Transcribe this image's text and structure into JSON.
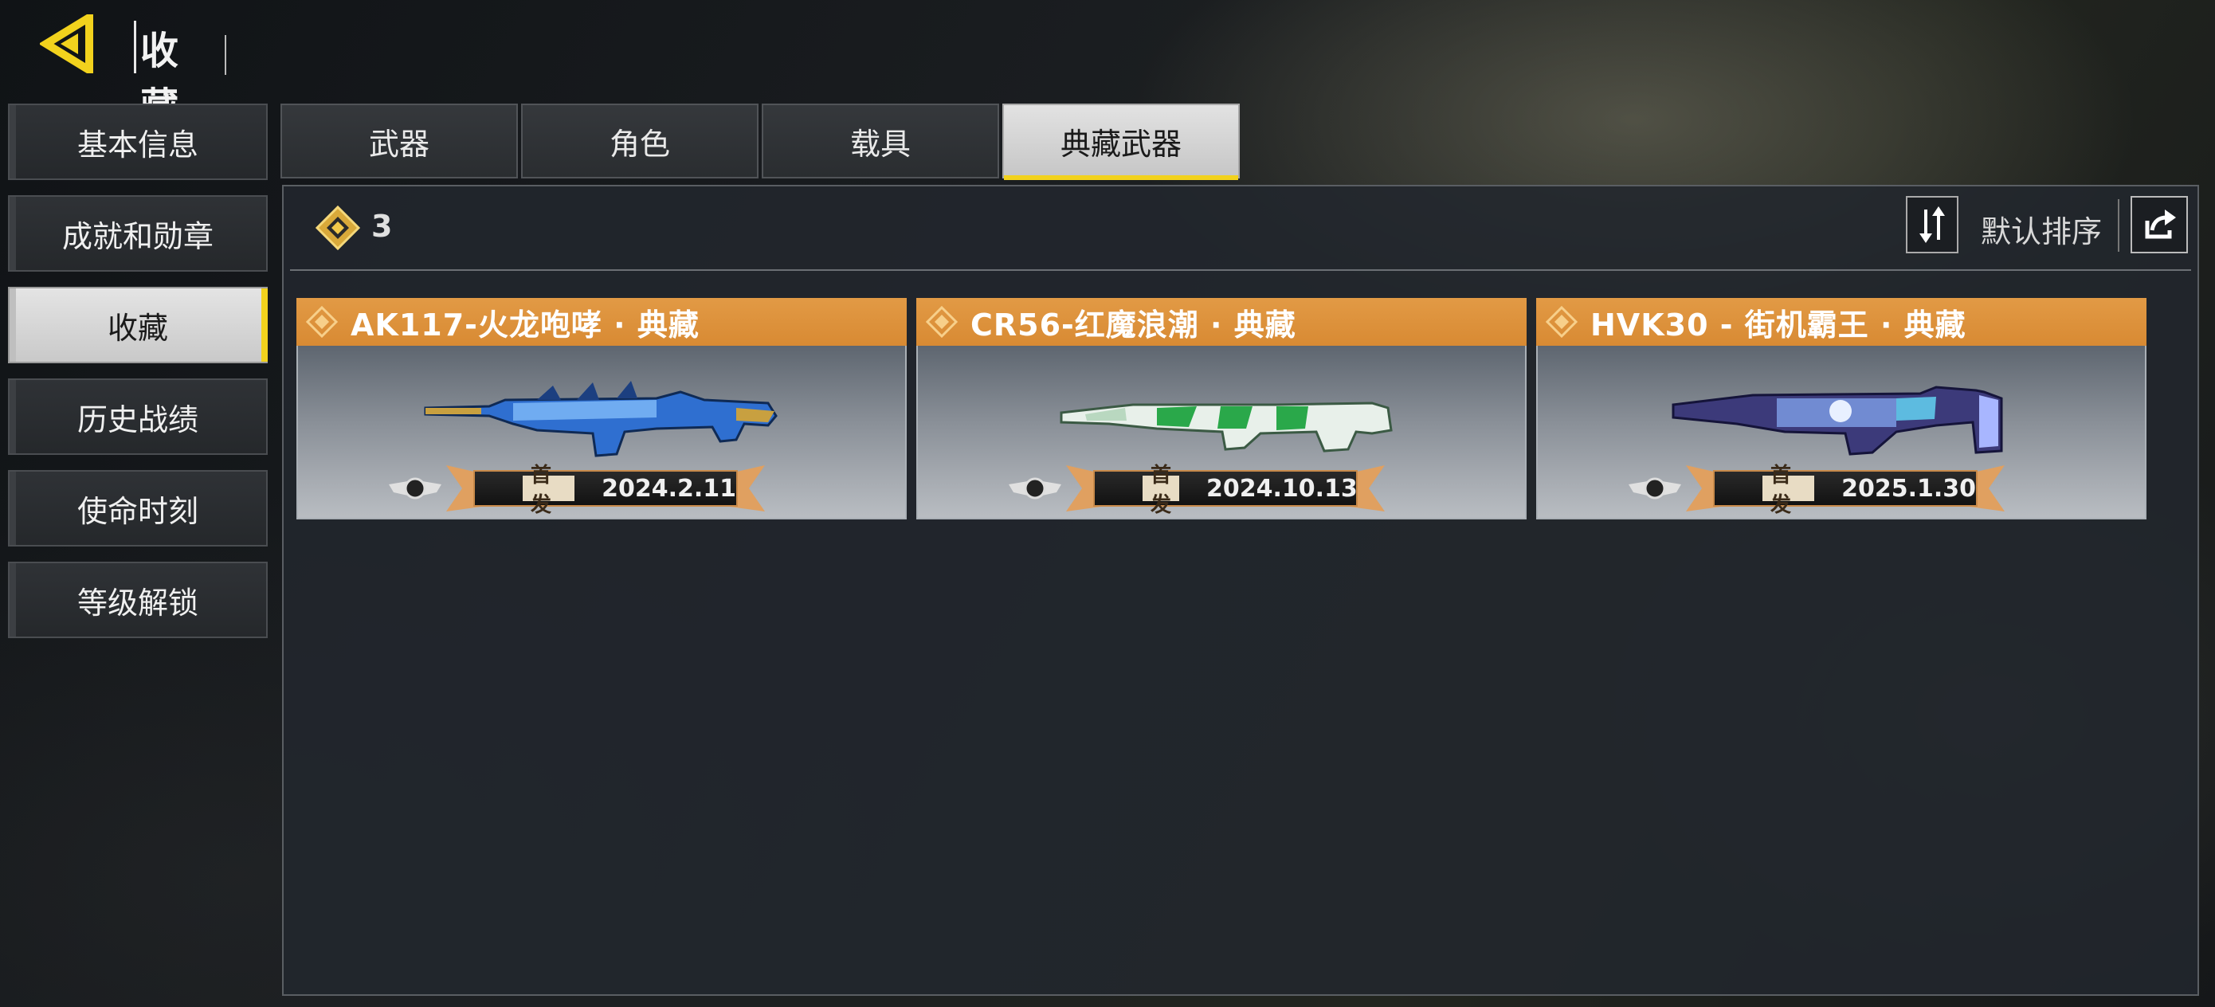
{
  "header": {
    "title": "收藏"
  },
  "sidebar": {
    "items": [
      {
        "label": "基本信息"
      },
      {
        "label": "成就和勋章"
      },
      {
        "label": "收藏"
      },
      {
        "label": "历史战绩"
      },
      {
        "label": "使命时刻"
      },
      {
        "label": "等级解锁"
      }
    ],
    "active_index": 2
  },
  "tabs": [
    {
      "label": "武器"
    },
    {
      "label": "角色"
    },
    {
      "label": "载具"
    },
    {
      "label": "典藏武器"
    }
  ],
  "active_tab_index": 3,
  "toolbar": {
    "count": "3",
    "sort_label": "默认排序",
    "sort_icon": "sort-swap-icon",
    "share_icon": "share-icon"
  },
  "cards": [
    {
      "title": "AK117-火龙咆哮 · 典藏",
      "tag": "首发",
      "date": "2024.2.11",
      "theme": "blue-gold"
    },
    {
      "title": "CR56-红魔浪潮 · 典藏",
      "tag": "首发",
      "date": "2024.10.13",
      "theme": "green-white"
    },
    {
      "title": "HVK30 - 街机霸王 · 典藏",
      "tag": "首发",
      "date": "2025.1.30",
      "theme": "blue-purple"
    }
  ],
  "colors": {
    "accent": "#f2d21d",
    "card_header": "#e29a45",
    "panel_bg": "#22272e"
  }
}
